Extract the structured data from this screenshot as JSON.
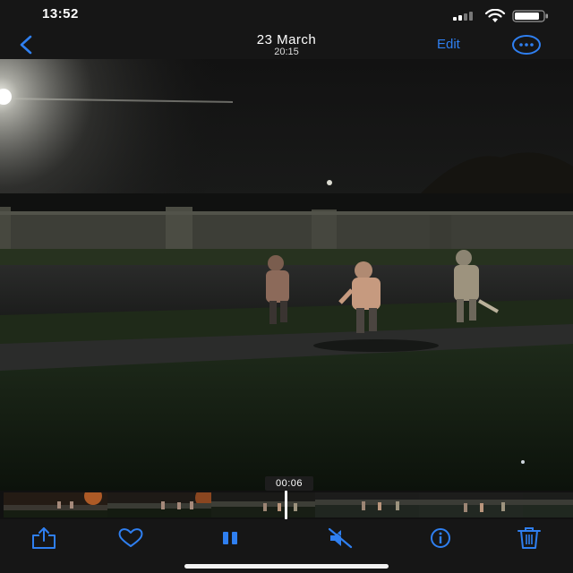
{
  "status_bar": {
    "time": "13:52",
    "icons": [
      "signal-icon",
      "wifi-icon",
      "battery-icon"
    ]
  },
  "nav": {
    "back_icon": "chevron-left-icon",
    "title": "23 March",
    "subtitle": "20:15",
    "edit_label": "Edit",
    "more_icon": "ellipsis-circle-icon"
  },
  "video": {
    "timestamp": "00:06",
    "thumbnail_count": 6
  },
  "toolbar": {
    "items": [
      "share-icon",
      "heart-icon",
      "pause-icon",
      "mute-icon",
      "info-icon",
      "trash-icon"
    ]
  },
  "colors": {
    "accent": "#2f7ff0",
    "bar_background": "#161616"
  }
}
